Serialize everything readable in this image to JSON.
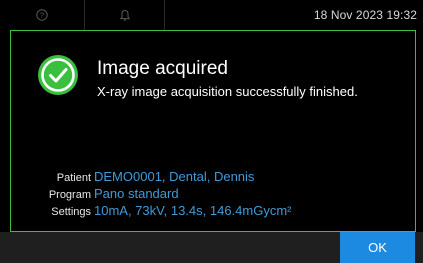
{
  "topbar": {
    "help_icon": "help-circle-icon",
    "bell_icon": "bell-icon",
    "datetime": "18 Nov 2023 19:32"
  },
  "dialog": {
    "status_icon": "check-circle-icon",
    "title": "Image acquired",
    "message": "X-ray image acquisition successfully finished.",
    "details": [
      {
        "label": "Patient",
        "value": "DEMO0001, Dental, Dennis"
      },
      {
        "label": "Program",
        "value": "Pano standard"
      },
      {
        "label": "Settings",
        "value": "10mA, 73kV, 13.4s, 146.4mGycm²"
      }
    ]
  },
  "footer": {
    "ok_label": "OK"
  },
  "colors": {
    "accent_green": "#3bbf3f",
    "link_blue": "#3f9bd8",
    "button_blue": "#1c8ae0"
  }
}
